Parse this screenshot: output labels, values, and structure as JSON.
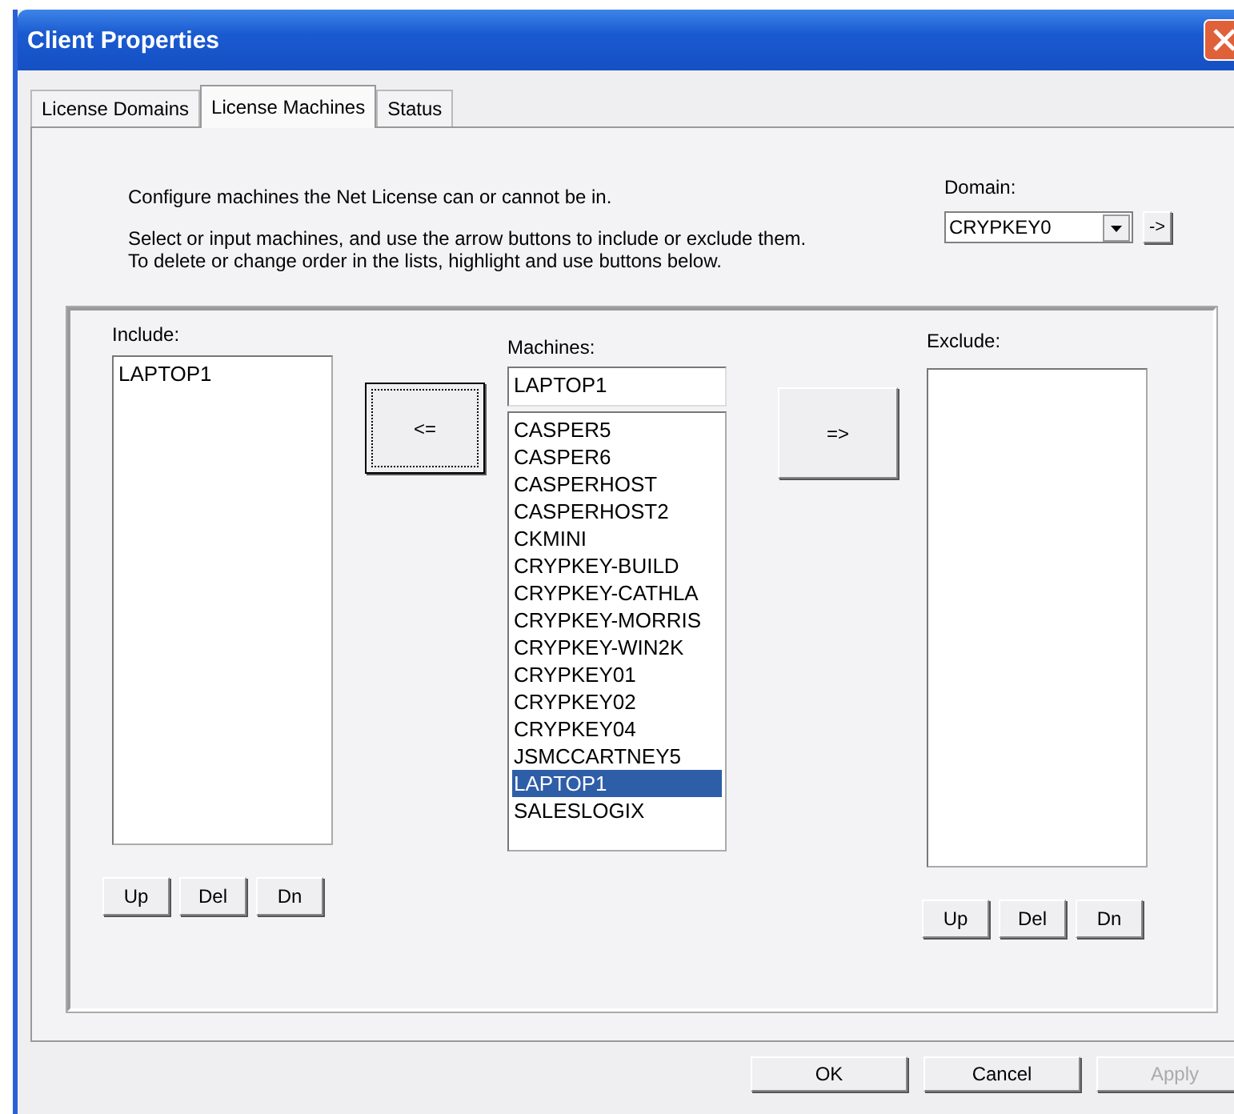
{
  "window": {
    "title": "Client Properties"
  },
  "tabs": [
    {
      "label": "License Domains",
      "selected": false
    },
    {
      "label": "License Machines",
      "selected": true
    },
    {
      "label": "Status",
      "selected": false
    }
  ],
  "intro": "Configure machines the Net License can or cannot be in.",
  "instructions": "Select or input machines, and use the arrow buttons to include or exclude them. To delete or change order in the lists, highlight and use buttons below.",
  "domain": {
    "label": "Domain:",
    "value": "CRYPKEY0",
    "go_button": "->"
  },
  "include": {
    "label": "Include:",
    "items": [
      {
        "text": "LAPTOP1",
        "selected": false
      }
    ],
    "buttons": [
      "Up",
      "Del",
      "Dn"
    ]
  },
  "include_button": {
    "label": "<=",
    "focused": true
  },
  "machines": {
    "label": "Machines:",
    "value": "LAPTOP1",
    "items": [
      {
        "text": "CASPER5",
        "selected": false
      },
      {
        "text": "CASPER6",
        "selected": false
      },
      {
        "text": "CASPERHOST",
        "selected": false
      },
      {
        "text": "CASPERHOST2",
        "selected": false
      },
      {
        "text": "CKMINI",
        "selected": false
      },
      {
        "text": "CRYPKEY-BUILD",
        "selected": false
      },
      {
        "text": "CRYPKEY-CATHLA",
        "selected": false
      },
      {
        "text": "CRYPKEY-MORRIS",
        "selected": false
      },
      {
        "text": "CRYPKEY-WIN2K",
        "selected": false
      },
      {
        "text": "CRYPKEY01",
        "selected": false
      },
      {
        "text": "CRYPKEY02",
        "selected": false
      },
      {
        "text": "CRYPKEY04",
        "selected": false
      },
      {
        "text": "JSMCCARTNEY5",
        "selected": false
      },
      {
        "text": "LAPTOP1",
        "selected": true
      },
      {
        "text": "SALESLOGIX",
        "selected": false
      }
    ]
  },
  "exclude_button": {
    "label": "=>",
    "focused": false
  },
  "exclude": {
    "label": "Exclude:",
    "buttons": [
      "Up",
      "Del",
      "Dn"
    ]
  },
  "footer_buttons": [
    {
      "label": "OK",
      "disabled": false
    },
    {
      "label": "Cancel",
      "disabled": false
    },
    {
      "label": "Apply",
      "disabled": true
    }
  ]
}
